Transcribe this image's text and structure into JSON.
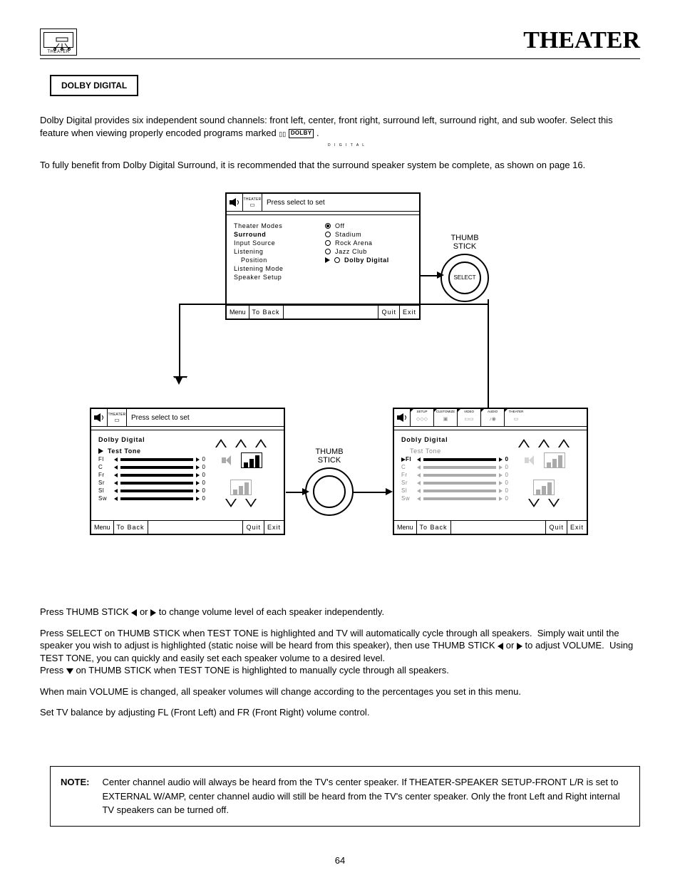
{
  "title": "THEATER",
  "tab_label": "THEATER",
  "section_heading": "DOLBY DIGITAL",
  "intro_p1a": "Dolby Digital provides six independent sound channels: front left, center, front right, surround left, surround right, and sub woofer. Select this feature when viewing  properly encoded programs marked ",
  "intro_p1b": " .",
  "dd_logo": "DOLBY",
  "dd_sub": "D I G I T A L",
  "intro_p2": "To fully benefit from Dolby Digital Surround, it is recommended that the surround speaker system be complete, as shown on page 16.",
  "menu_top": {
    "hdr_tab": "THEATER",
    "hdr_text": "Press select to set",
    "left_items": [
      "Theater Modes",
      "Surround",
      "Input Source",
      "Listening",
      "Position",
      "Listening Mode",
      "Speaker Setup"
    ],
    "right_items": [
      "Off",
      "Stadium",
      "Rock Arena",
      "Jazz Club",
      "Dolby Digital"
    ],
    "ftr": [
      "Menu",
      "To Back",
      "Quit",
      "Exit"
    ]
  },
  "thumb1": {
    "label": "THUMB\nSTICK",
    "btn": "SELECT"
  },
  "thumb2": {
    "label": "THUMB\nSTICK",
    "btn": ""
  },
  "menu_left": {
    "hdr_tab": "THEATER",
    "hdr_text": "Press select to set",
    "title": "Dolby Digital",
    "sel": "Test Tone",
    "sliders": [
      "Fl",
      "C",
      "Fr",
      "Sr",
      "Sl",
      "Sw"
    ],
    "ftr": [
      "Menu",
      "To Back",
      "Quit",
      "Exit"
    ]
  },
  "menu_right": {
    "hdr_tabs": [
      "SETUP",
      "CUSTOMIZE",
      "VIDEO",
      "AUDIO",
      "THEATER"
    ],
    "title": "Dobly Digital",
    "sel": "Test Tone",
    "sel_arrow_target": "Fl",
    "sliders": [
      "Fl",
      "C",
      "Fr",
      "Sr",
      "Sl",
      "Sw"
    ],
    "ftr": [
      "Menu",
      "To Back",
      "Quit",
      "Exit"
    ]
  },
  "instr1": "Press THUMB STICK ◄ or ► to change volume level of each speaker independently.",
  "instr2": "Press SELECT on THUMB STICK when TEST TONE is highlighted and TV will automatically cycle through all speakers.  Simply wait until the speaker you wish to adjust is highlighted (static noise will be heard from this speaker), then use THUMB STICK ◄ or ► to adjust VOLUME.  Using TEST TONE, you can quickly and easily set each speaker volume to a desired level.",
  "instr3": "Press ▼ on THUMB STICK when TEST TONE is highlighted to manually cycle through all speakers.",
  "instr4": "When main VOLUME is changed, all speaker volumes will change according to the percentages you set in this menu.",
  "instr5": "Set TV balance by adjusting FL (Front Left) and FR (Front Right) volume control.",
  "note_label": "NOTE:",
  "note_text": "Center channel audio will always be heard from the TV's center speaker.  If THEATER-SPEAKER SETUP-FRONT L/R is set to EXTERNAL W/AMP, center channel audio will still be heard from the TV's center speaker.  Only the front Left and Right internal TV speakers can be turned off.",
  "page_number": "64"
}
